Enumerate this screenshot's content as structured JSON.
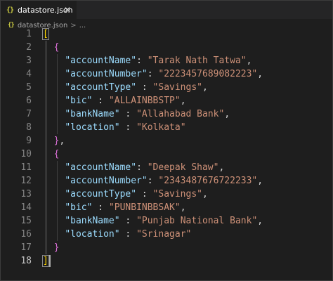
{
  "tab": {
    "icon": "{}",
    "filename": "datastore.json",
    "close": "✕"
  },
  "breadcrumb": {
    "icon": "{}",
    "file": "datastore.json",
    "separator": ">",
    "symbol": "..."
  },
  "code": {
    "open_array": "[",
    "close_array": "]",
    "records": [
      {
        "fields": [
          {
            "key": "accountName",
            "value": "Tarak Nath Tatwa",
            "sep": ": "
          },
          {
            "key": "accountNumber",
            "value": "2223457689082223",
            "sep": ": "
          },
          {
            "key": "accountType",
            "value": "Savings",
            "sep": " : "
          },
          {
            "key": "bic",
            "value": "ALLAINBBSTP",
            "sep": " : "
          },
          {
            "key": "bankName",
            "value": "Allahabad Bank",
            "sep": " : "
          },
          {
            "key": "location",
            "value": "Kolkata",
            "sep": " : "
          }
        ]
      },
      {
        "fields": [
          {
            "key": "accountName",
            "value": "Deepak Shaw",
            "sep": ": "
          },
          {
            "key": "accountNumber",
            "value": "2343487676722233",
            "sep": ": "
          },
          {
            "key": "accountType",
            "value": "Savings",
            "sep": " : "
          },
          {
            "key": "bic",
            "value": "PUNBINBBSAK",
            "sep": " : "
          },
          {
            "key": "bankName",
            "value": "Punjab National Bank",
            "sep": " : "
          },
          {
            "key": "location",
            "value": "Srinagar",
            "sep": " : "
          }
        ]
      }
    ]
  },
  "colors": {
    "background": "#1e1e1e",
    "key": "#9cdcfe",
    "string": "#ce9178",
    "bracket_outer": "#ffd700",
    "bracket_inner": "#da70d6",
    "line_number": "#858585"
  }
}
